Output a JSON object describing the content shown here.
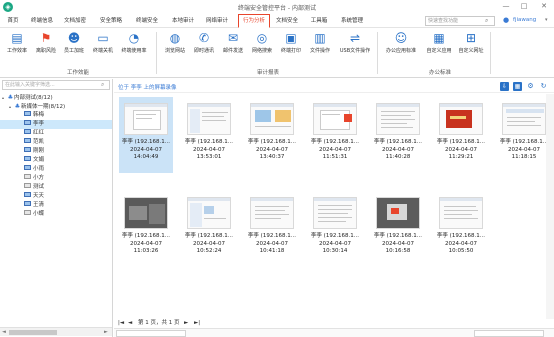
{
  "window": {
    "title": "终端安全管控平台 - 内部测试",
    "logo_icon": "shield-logo-icon"
  },
  "menu": {
    "items": [
      "首页",
      "终端信息",
      "文档加密",
      "安全策略",
      "终端安全",
      "本地审计",
      "网络审计",
      "行为分析",
      "文档安全",
      "工具箱",
      "系统管理"
    ],
    "active": "行为分析",
    "search_placeholder": "快速查找功能",
    "user": "fjiawang"
  },
  "ribbon": {
    "groups": [
      {
        "label": "工作效能",
        "tools": [
          {
            "label": "工作效率",
            "icon": "efficiency-icon",
            "color": "#2a72c7"
          },
          {
            "label": "离职风险",
            "icon": "resign-risk-icon",
            "color": "#e8452c"
          },
          {
            "label": "员工加班",
            "icon": "overtime-icon",
            "color": "#2a72c7"
          },
          {
            "label": "终端关机",
            "icon": "shutdown-icon",
            "color": "#2a72c7"
          },
          {
            "label": "终端使用率",
            "icon": "usage-rate-icon",
            "color": "#2a72c7"
          }
        ]
      },
      {
        "label": "审计报表",
        "tools": [
          {
            "label": "浏览网站",
            "icon": "browse-web-icon",
            "color": "#2a72c7"
          },
          {
            "label": "即时通讯",
            "icon": "im-icon",
            "color": "#2a72c7"
          },
          {
            "label": "邮件发送",
            "icon": "mail-icon",
            "color": "#2a72c7"
          },
          {
            "label": "网络搜索",
            "icon": "web-search-icon",
            "color": "#2a72c7"
          },
          {
            "label": "终端打印",
            "icon": "printer-icon",
            "color": "#2a72c7"
          },
          {
            "label": "文件操作",
            "icon": "file-op-icon",
            "color": "#2a72c7"
          },
          {
            "label": "USB文件操作",
            "icon": "usb-icon",
            "color": "#2a72c7"
          }
        ]
      },
      {
        "label": "办公标准",
        "tools": [
          {
            "label": "办公应用标准",
            "icon": "office-standard-icon",
            "color": "#2a72c7"
          },
          {
            "label": "自定义应用",
            "icon": "custom-app-icon",
            "color": "#2a72c7"
          },
          {
            "label": "自定义网址",
            "icon": "custom-url-icon",
            "color": "#2a72c7"
          }
        ]
      }
    ]
  },
  "tree": {
    "search_placeholder": "在此输入关键字筛选...",
    "root": "内部测试(8/12)",
    "group": "新媒体一期(8/12)",
    "items": [
      "韩梅",
      "李李",
      "红红",
      "范凯",
      "刚刚",
      "文娟",
      "小雨",
      "小方",
      "测试",
      "天天",
      "王清",
      "小蝶"
    ],
    "selected": "李李"
  },
  "content": {
    "path": "位于 李李 上的屏幕录像",
    "screenshots": [
      {
        "name": "李李 (192.168.1...",
        "date": "2024-04-07",
        "time": "14:04:49"
      },
      {
        "name": "李李 (192.168.1...",
        "date": "2024-04-07",
        "time": "13:53:01"
      },
      {
        "name": "李李 (192.168.1...",
        "date": "2024-04-07",
        "time": "13:40:37"
      },
      {
        "name": "李李 (192.168.1...",
        "date": "2024-04-07",
        "time": "11:51:31"
      },
      {
        "name": "李李 (192.168.1...",
        "date": "2024-04-07",
        "time": "11:40:28"
      },
      {
        "name": "李李 (192.168.1...",
        "date": "2024-04-07",
        "time": "11:29:21"
      },
      {
        "name": "李李 (192.168.1...",
        "date": "2024-04-07",
        "time": "11:18:15"
      },
      {
        "name": "李李 (192.168.1...",
        "date": "2024-04-07",
        "time": "11:03:26"
      },
      {
        "name": "李李 (192.168.1...",
        "date": "2024-04-07",
        "time": "10:52:24"
      },
      {
        "name": "李李 (192.168.1...",
        "date": "2024-04-07",
        "time": "10:41:18"
      },
      {
        "name": "李李 (192.168.1...",
        "date": "2024-04-07",
        "time": "10:30:14"
      },
      {
        "name": "李李 (192.168.1...",
        "date": "2024-04-07",
        "time": "10:16:58"
      },
      {
        "name": "李李 (192.168.1...",
        "date": "2024-04-07",
        "time": "10:05:50"
      }
    ],
    "pager": {
      "first": "|◄",
      "prev": "◄",
      "page_text": "第 1 页，共 1 页",
      "next": "►",
      "last": "►|"
    }
  }
}
